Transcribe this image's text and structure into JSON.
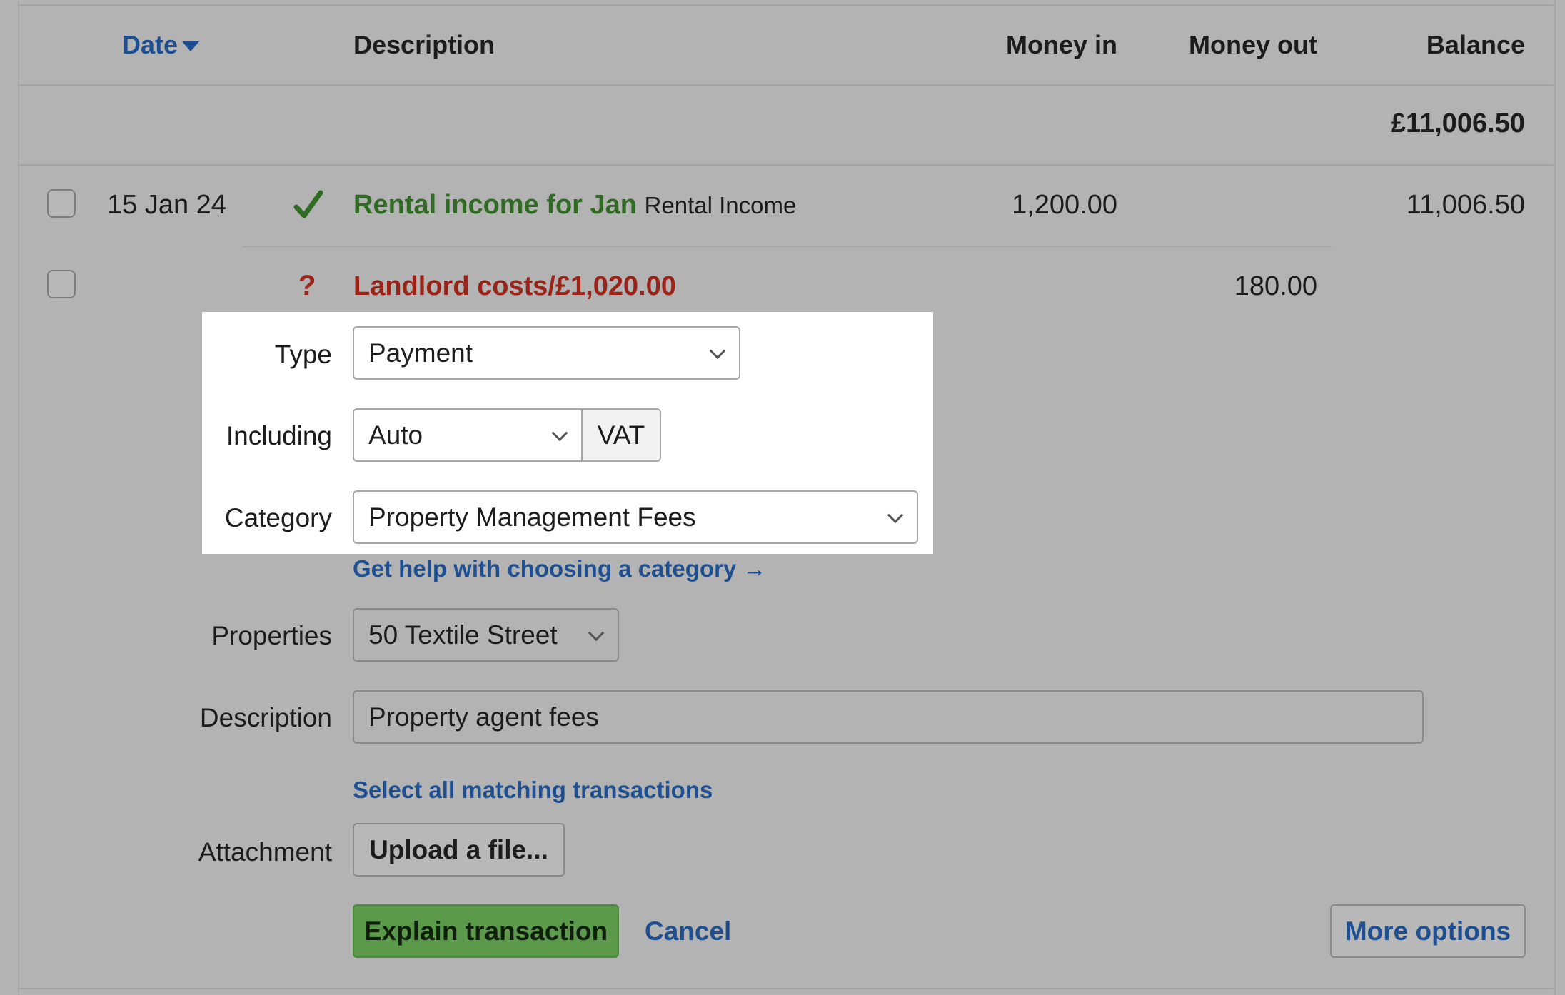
{
  "table": {
    "headers": {
      "date": "Date",
      "description": "Description",
      "money_in": "Money in",
      "money_out": "Money out",
      "balance": "Balance"
    },
    "opening_balance": "£11,006.50",
    "rows": [
      {
        "date": "15 Jan 24",
        "status_icon": "check-icon",
        "title": "Rental income for Jan",
        "subtitle": "Rental Income",
        "money_in": "1,200.00",
        "balance": "11,006.50"
      },
      {
        "status_icon": "question-icon",
        "title": "Landlord costs/£1,020.00",
        "money_out": "180.00"
      }
    ]
  },
  "form": {
    "type_label": "Type",
    "type_value": "Payment",
    "including_label": "Including",
    "including_value": "Auto",
    "vat_label": "VAT",
    "category_label": "Category",
    "category_value": "Property Management Fees",
    "category_help": "Get help with choosing a category →",
    "properties_label": "Properties",
    "properties_value": "50 Textile Street",
    "description_label": "Description",
    "description_value": "Property agent fees",
    "select_matching": "Select all matching transactions",
    "attachment_label": "Attachment",
    "upload_button": "Upload a file...",
    "explain_button": "Explain transaction",
    "cancel_link": "Cancel",
    "more_options": "More options"
  },
  "colors": {
    "link_blue": "#1d4f91",
    "success_green": "#2f6b22",
    "error_red": "#9a2318",
    "button_green": "#5a9a4a"
  }
}
